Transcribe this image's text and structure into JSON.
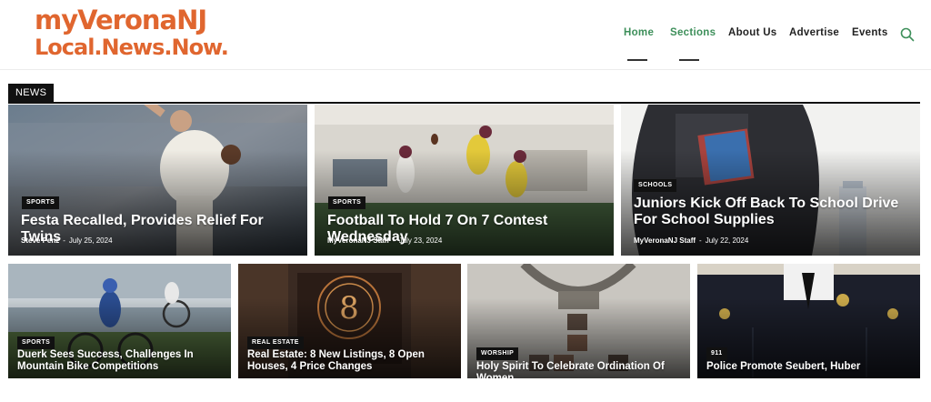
{
  "site": {
    "logo_line1": "myVeronaNJ",
    "logo_line2": "Local.News.Now."
  },
  "nav": {
    "items": [
      {
        "label": "Home",
        "active": true
      },
      {
        "label": "Sections",
        "active": true
      },
      {
        "label": "About Us",
        "active": false
      },
      {
        "label": "Advertise",
        "active": false
      },
      {
        "label": "Events",
        "active": false
      }
    ],
    "search_icon": "search-icon"
  },
  "section": {
    "label": "NEWS"
  },
  "colors": {
    "brand": "#e0662f",
    "active_nav": "#3d8f5a",
    "dark": "#111111"
  },
  "articles": [
    {
      "category": "SPORTS",
      "title": "Festa Recalled, Provides Relief For Twins",
      "author": "Steve Penz",
      "date": "July 25, 2024"
    },
    {
      "category": "SPORTS",
      "title": "Football To Hold 7 On 7 Contest Wednesday",
      "author": "MyVeronaNJ Staff",
      "date": "July 23, 2024"
    },
    {
      "category": "SCHOOLS",
      "title": "Juniors Kick Off Back To School Drive For School Supplies",
      "author": "MyVeronaNJ Staff",
      "date": "July 22, 2024"
    },
    {
      "category": "SPORTS",
      "title": "Duerk Sees Success, Challenges In Mountain Bike Competitions"
    },
    {
      "category": "REAL ESTATE",
      "title": "Real Estate: 8 New Listings, 8 Open Houses, 4 Price Changes"
    },
    {
      "category": "WORSHIP",
      "title": "Holy Spirit To Celebrate Ordination Of Women"
    },
    {
      "category": "911",
      "title": "Police Promote Seubert, Huber"
    }
  ]
}
